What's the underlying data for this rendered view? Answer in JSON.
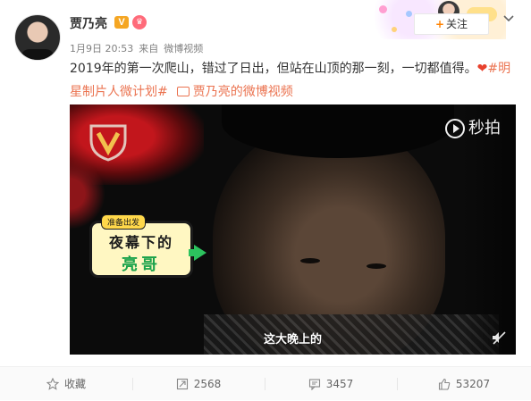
{
  "author": {
    "name": "贾乃亮",
    "verified_badge": "V",
    "vip_badge": "♛"
  },
  "meta": {
    "date": "1月9日 20:53",
    "source_prefix": "来自",
    "source": "微博视频"
  },
  "follow": {
    "plus": "+",
    "label": "关注"
  },
  "post": {
    "text": "2019年的第一次爬山，错过了日出，但站在山顶的那一刻，一切都值得。",
    "heart": "❤",
    "hashtag": "#明星制片人微计划#",
    "video_link": "贾乃亮的微博视频"
  },
  "video": {
    "watermark": "秒拍",
    "sticker_tag": "准备出发",
    "sticker_line1": "夜幕下的",
    "sticker_line2": "亮哥",
    "subtitle": "这大晚上的"
  },
  "actions": {
    "collect": "收藏",
    "repost": "2568",
    "comment": "3457",
    "like": "53207"
  },
  "colors": {
    "link": "#eb7350",
    "follow_plus": "#ff8200",
    "heart": "#e8412d"
  }
}
